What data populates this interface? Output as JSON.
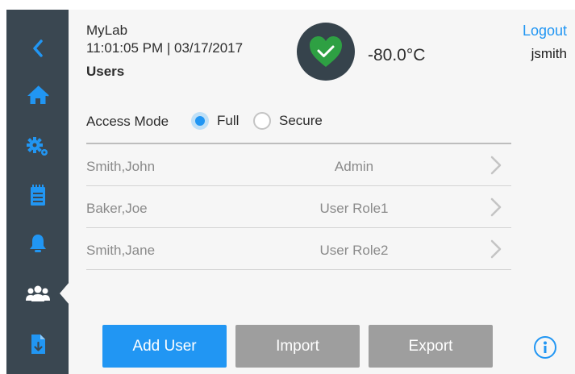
{
  "header": {
    "lab_name": "MyLab",
    "datetime": "11:01:05 PM | 03/17/2017",
    "page_title": "Users",
    "temperature": "-80.0°C",
    "status_icon": "heart-check-icon",
    "logout_label": "Logout",
    "username": "jsmith"
  },
  "sidebar": {
    "items": [
      {
        "icon": "back-chevron-icon"
      },
      {
        "icon": "home-icon"
      },
      {
        "icon": "settings-gears-icon"
      },
      {
        "icon": "notepad-icon"
      },
      {
        "icon": "bell-icon"
      },
      {
        "icon": "users-icon",
        "active": true
      },
      {
        "icon": "document-download-icon"
      }
    ]
  },
  "access": {
    "label": "Access Mode",
    "options": [
      {
        "label": "Full",
        "selected": true
      },
      {
        "label": "Secure",
        "selected": false
      }
    ]
  },
  "users": [
    {
      "name": "Smith,John",
      "role": "Admin"
    },
    {
      "name": "Baker,Joe",
      "role": "User Role1"
    },
    {
      "name": "Smith,Jane",
      "role": "User Role2"
    }
  ],
  "actions": {
    "add_label": "Add User",
    "import_label": "Import",
    "export_label": "Export"
  },
  "colors": {
    "sidebar": "#3a4751",
    "accent": "#2196f3",
    "status_ok": "#2ea043",
    "button_gray": "#9e9e9e",
    "background": "#f6f6f6"
  }
}
